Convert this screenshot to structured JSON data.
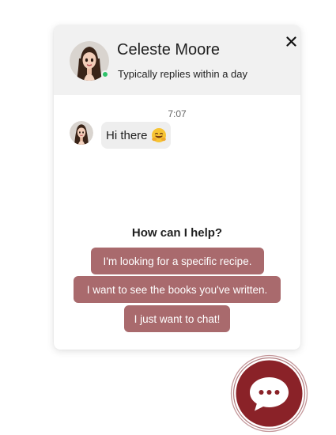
{
  "colors": {
    "accent": "#a96a6d",
    "launcher": "#8a2228",
    "header_bg": "#f1f1f1",
    "online": "#2ec26a"
  },
  "header": {
    "agent_name": "Celeste Moore",
    "status": "Typically replies within a day",
    "close_icon": "close-icon"
  },
  "conversation": {
    "timestamp": "7:07",
    "message": "Hi there",
    "message_emoji": "hugging-face-emoji"
  },
  "help": {
    "title": "How can I help?",
    "options": [
      "I'm looking for a specific recipe.",
      "I want to see the books you've written.",
      "I just want to chat!"
    ]
  },
  "launcher": {
    "icon": "chat-bubble-icon"
  }
}
